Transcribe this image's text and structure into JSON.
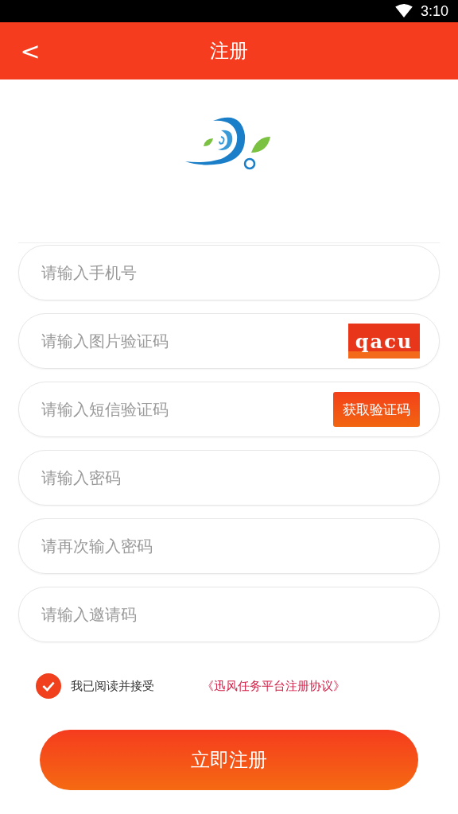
{
  "status_bar": {
    "time": "3:10"
  },
  "header": {
    "back": "<",
    "title": "注册"
  },
  "fields": [
    {
      "kind": "plain",
      "placeholder": "请输入手机号"
    },
    {
      "kind": "captcha",
      "placeholder": "请输入图片验证码",
      "captcha": "qacu"
    },
    {
      "kind": "sms",
      "placeholder": "请输入短信验证码",
      "button": "获取验证码"
    },
    {
      "kind": "plain",
      "placeholder": "请输入密码"
    },
    {
      "kind": "plain",
      "placeholder": "请再次输入密码"
    },
    {
      "kind": "plain",
      "placeholder": "请输入邀请码"
    }
  ],
  "agreement": {
    "checked": true,
    "label": "我已阅读并接受",
    "link": "《迅风任务平台注册协议》"
  },
  "submit": "立即注册"
}
